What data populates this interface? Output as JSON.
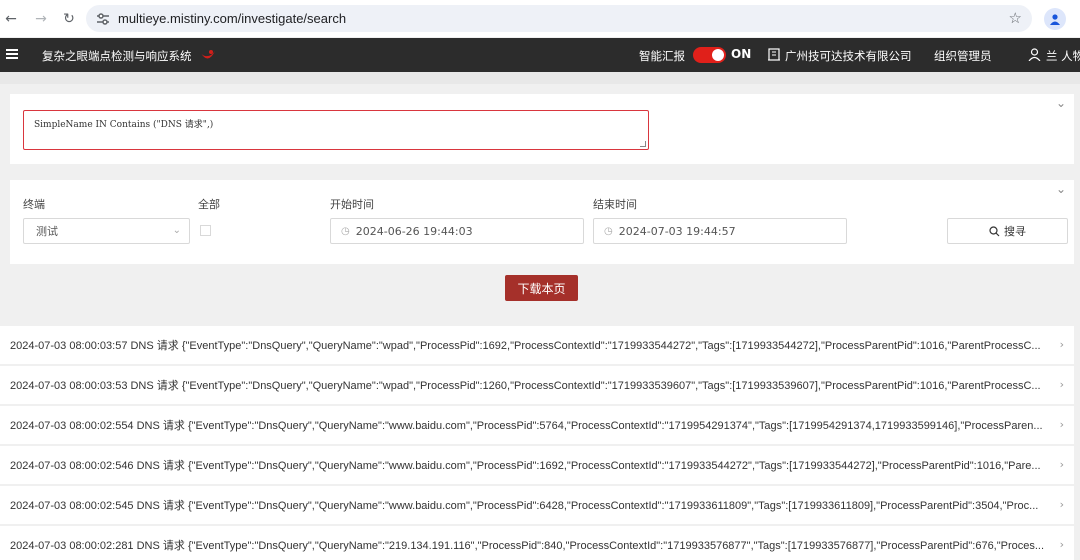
{
  "browser": {
    "url": "multieye.mistiny.com/investigate/search"
  },
  "header": {
    "title": "复杂之眼端点检测与响应系统",
    "ai_label": "智能汇报",
    "toggle_label": "ON",
    "company": "广州技可达技术有限公司",
    "role": "组织管理员",
    "user": "兰 人物"
  },
  "query": {
    "text": "SimpleName IN Contains (\"DNS 请求\",)"
  },
  "filters": {
    "terminal_label": "终端",
    "all_label": "全部",
    "start_label": "开始时间",
    "end_label": "结束时间",
    "terminal_value": "测试",
    "start_value": "2024-06-26 19:44:03",
    "end_value": "2024-07-03 19:44:57",
    "search_label": "搜寻"
  },
  "download_label": "下载本页",
  "results": [
    "2024-07-03 08:00:03:57 DNS 请求 {\"EventType\":\"DnsQuery\",\"QueryName\":\"wpad\",\"ProcessPid\":1692,\"ProcessContextId\":\"1719933544272\",\"Tags\":[1719933544272],\"ProcessParentPid\":1016,\"ParentProcessC...",
    "2024-07-03 08:00:03:53 DNS 请求 {\"EventType\":\"DnsQuery\",\"QueryName\":\"wpad\",\"ProcessPid\":1260,\"ProcessContextId\":\"1719933539607\",\"Tags\":[1719933539607],\"ProcessParentPid\":1016,\"ParentProcessC...",
    "2024-07-03 08:00:02:554 DNS 请求 {\"EventType\":\"DnsQuery\",\"QueryName\":\"www.baidu.com\",\"ProcessPid\":5764,\"ProcessContextId\":\"1719954291374\",\"Tags\":[1719954291374,1719933599146],\"ProcessParen...",
    "2024-07-03 08:00:02:546 DNS 请求 {\"EventType\":\"DnsQuery\",\"QueryName\":\"www.baidu.com\",\"ProcessPid\":1692,\"ProcessContextId\":\"1719933544272\",\"Tags\":[1719933544272],\"ProcessParentPid\":1016,\"Pare...",
    "2024-07-03 08:00:02:545 DNS 请求 {\"EventType\":\"DnsQuery\",\"QueryName\":\"www.baidu.com\",\"ProcessPid\":6428,\"ProcessContextId\":\"1719933611809\",\"Tags\":[1719933611809],\"ProcessParentPid\":3504,\"Proc...",
    "2024-07-03 08:00:02:281 DNS 请求 {\"EventType\":\"DnsQuery\",\"QueryName\":\"219.134.191.116\",\"ProcessPid\":840,\"ProcessContextId\":\"1719933576877\",\"Tags\":[1719933576877],\"ProcessParentPid\":676,\"Proces..."
  ]
}
